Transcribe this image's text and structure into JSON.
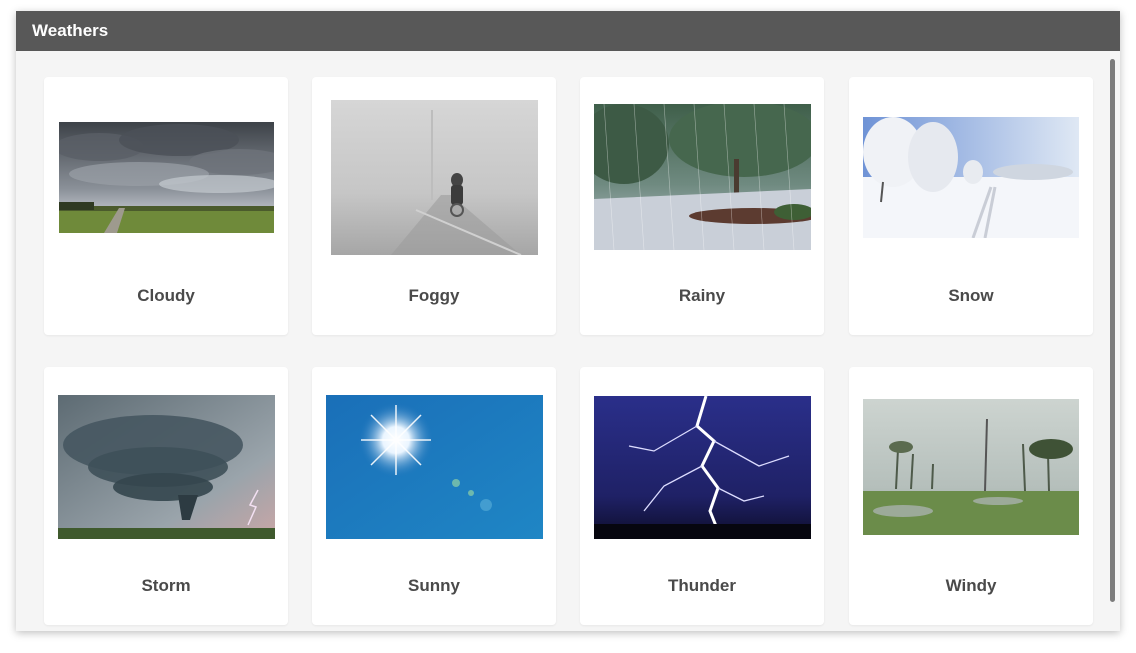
{
  "window": {
    "title": "Weathers"
  },
  "items": [
    {
      "label": "Cloudy",
      "icon": "cloudy-sky-photo"
    },
    {
      "label": "Foggy",
      "icon": "foggy-road-photo"
    },
    {
      "label": "Rainy",
      "icon": "rainy-park-photo"
    },
    {
      "label": "Snow",
      "icon": "snowy-field-photo"
    },
    {
      "label": "Storm",
      "icon": "storm-supercell-photo"
    },
    {
      "label": "Sunny",
      "icon": "sunny-sky-photo"
    },
    {
      "label": "Thunder",
      "icon": "lightning-photo"
    },
    {
      "label": "Windy",
      "icon": "windy-palms-photo"
    }
  ],
  "colors": {
    "titlebar": "#585858",
    "background": "#f5f5f5",
    "card": "#ffffff",
    "label": "#4a4a4a"
  }
}
